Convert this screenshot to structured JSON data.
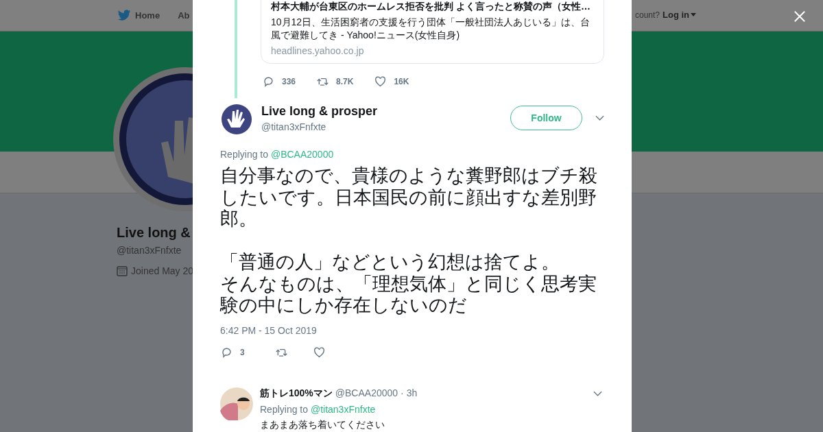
{
  "background_page": {
    "nav": {
      "items": [
        {
          "label": "Home",
          "kind": "home"
        },
        {
          "label": "Ab",
          "kind": "plain"
        }
      ],
      "account_prompt": "count?",
      "login": "Log in"
    },
    "profile": {
      "name": "Live long &",
      "handle": "@titan3xFnfxte",
      "joined": "Joined May 20"
    }
  },
  "modal": {
    "quoted_card": {
      "title": "村本大輔が台東区のホームレス拒否を批判 よく言ったと称賛の声（女性…",
      "description": "10月12日、生活困窮者の支援を行う団体「一般社団法人あじいる」は、台風で避難してき - Yahoo!ニュース(女性自身)",
      "domain": "headlines.yahoo.co.jp"
    },
    "parent_actions": [
      {
        "kind": "reply",
        "count": "336"
      },
      {
        "kind": "retweet",
        "count": "8.7K"
      },
      {
        "kind": "like",
        "count": "16K"
      }
    ],
    "tweet": {
      "name": "Live long & prosper",
      "handle": "@titan3xFnfxte",
      "follow": "Follow",
      "replying_label": "Replying to",
      "replying_to": "@BCAA20000",
      "text": [
        "自分事なので、貴様のような糞野郎はブチ殺したいです。日本国民の前に顔出すな差別野郎。",
        "「普通の人」などという幻想は捨てよ。",
        "そんなものは、「理想気体」と同じく思考実験の中にしか存在しないのだ"
      ],
      "timestamp": "6:42 PM - 15 Oct 2019",
      "actions": [
        {
          "kind": "reply",
          "count": "3"
        },
        {
          "kind": "retweet"
        },
        {
          "kind": "like"
        }
      ]
    },
    "reply": {
      "name": "筋トレ100%マン",
      "handle": "@BCAA20000",
      "time": "· 3h",
      "replying_label": "Replying to",
      "replying_to": "@titan3xFnfxte",
      "text": "まあまあ落ち着いてください"
    }
  }
}
